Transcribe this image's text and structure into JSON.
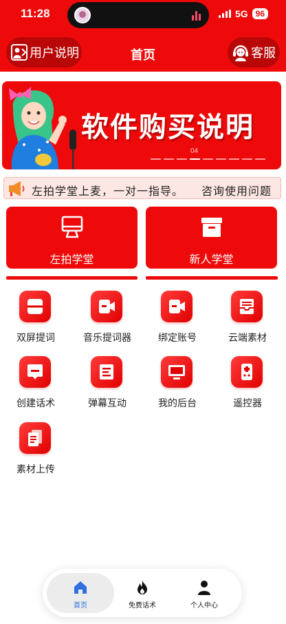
{
  "status": {
    "time": "11:28",
    "network": "5G",
    "battery": "96"
  },
  "header": {
    "left_button": "用户说明",
    "title": "首页",
    "right_button": "客服"
  },
  "banner": {
    "text": "软件购买说明",
    "page_indicator": "04"
  },
  "notice": {
    "text": "左拍学堂上麦，一对一指导。　　咨询使用问题"
  },
  "cards": [
    {
      "label": "左拍学堂",
      "icon": "monitor-icon"
    },
    {
      "label": "新人学堂",
      "icon": "archive-box-icon"
    }
  ],
  "grid": [
    {
      "label": "双屏提词",
      "icon": "split-screen-icon"
    },
    {
      "label": "音乐提词器",
      "icon": "video-camera-icon"
    },
    {
      "label": "绑定账号",
      "icon": "video-camera-icon"
    },
    {
      "label": "云端素材",
      "icon": "inbox-tray-icon"
    },
    {
      "label": "创建话术",
      "icon": "chat-bubble-icon"
    },
    {
      "label": "弹幕互动",
      "icon": "list-document-icon"
    },
    {
      "label": "我的后台",
      "icon": "desktop-icon"
    },
    {
      "label": "遥控器",
      "icon": "remote-control-icon"
    },
    {
      "label": "素材上传",
      "icon": "upload-files-icon"
    }
  ],
  "tabs": [
    {
      "label": "首页",
      "icon": "home-icon",
      "active": true
    },
    {
      "label": "免费话术",
      "icon": "fire-icon",
      "active": false
    },
    {
      "label": "个人中心",
      "icon": "user-icon",
      "active": false
    }
  ],
  "colors": {
    "brand": "#ee0a0a",
    "active_tab": "#2f6fe0"
  }
}
